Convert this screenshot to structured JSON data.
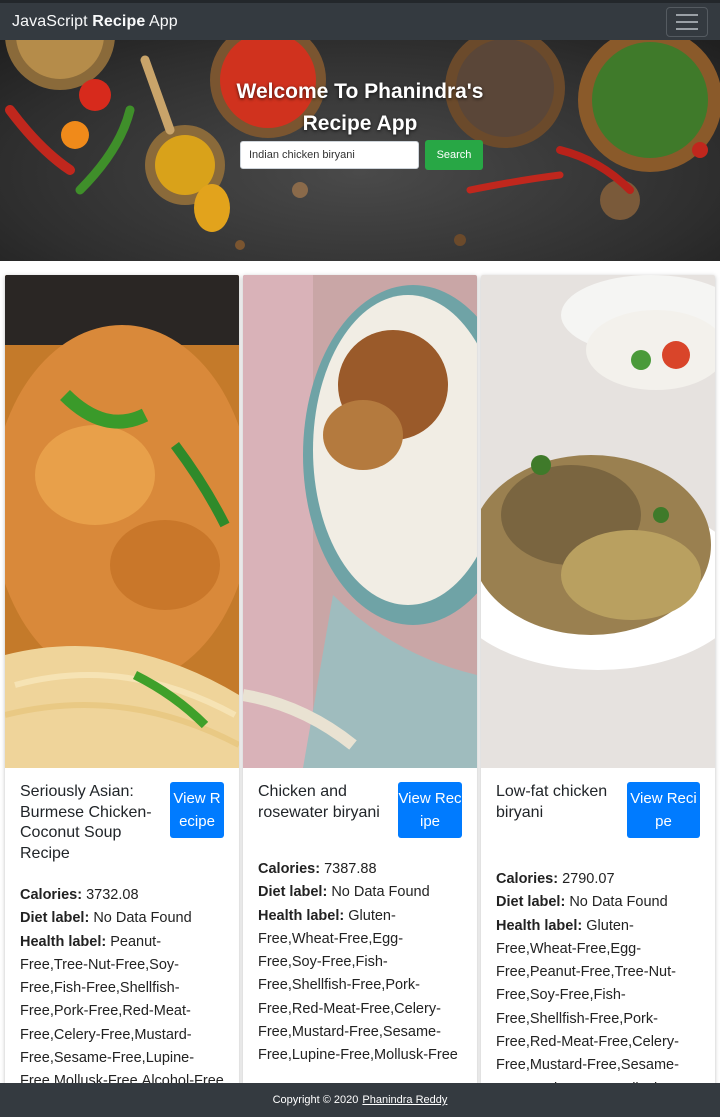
{
  "navbar": {
    "brand_pre": "JavaScript",
    "brand_bold": "Recipe",
    "brand_post": "App",
    "toggle_icon": "hamburger-icon"
  },
  "hero": {
    "title_line1": "Welcome To Phanindra's",
    "title_line2": "Recipe App",
    "search_value": "Indian chicken biryani",
    "search_button": "Search"
  },
  "cards": [
    {
      "title": "Seriously Asian: Burmese Chicken-Coconut Soup Recipe",
      "button": "View Recipe",
      "calories_label": "Calories:",
      "calories": "3732.08",
      "diet_label_label": "Diet label:",
      "diet_label": "No Data Found",
      "health_label_label": "Health label:",
      "health_label": "Peanut-Free,Tree-Nut-Free,Soy-Free,Fish-Free,Shellfish-Free,Pork-Free,Red-Meat-Free,Celery-Free,Mustard-Free,Sesame-Free,Lupine-Free,Mollusk-Free,Alcohol-Free"
    },
    {
      "title": "Chicken and rosewater biryani",
      "button": "View Recipe",
      "calories_label": "Calories:",
      "calories": "7387.88",
      "diet_label_label": "Diet label:",
      "diet_label": "No Data Found",
      "health_label_label": "Health label:",
      "health_label": "Gluten-Free,Wheat-Free,Egg-Free,Soy-Free,Fish-Free,Shellfish-Free,Pork-Free,Red-Meat-Free,Celery-Free,Mustard-Free,Sesame-Free,Lupine-Free,Mollusk-Free"
    },
    {
      "title": "Low-fat chicken biryani",
      "button": "View Recipe",
      "calories_label": "Calories:",
      "calories": "2790.07",
      "diet_label_label": "Diet label:",
      "diet_label": "No Data Found",
      "health_label_label": "Health label:",
      "health_label": "Gluten-Free,Wheat-Free,Egg-Free,Peanut-Free,Tree-Nut-Free,Soy-Free,Fish-Free,Shellfish-Free,Pork-Free,Red-Meat-Free,Celery-Free,Mustard-Free,Sesame-Free,Lupine-Free,Mollusk-Free"
    }
  ],
  "footer": {
    "copyright": "Copyright © 2020",
    "author": "Phanindra Reddy"
  },
  "colors": {
    "navbar": "#343a40",
    "search_button": "#28a745",
    "view_button": "#007bff"
  }
}
